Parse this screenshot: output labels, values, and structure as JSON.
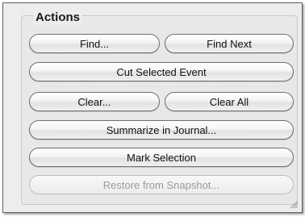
{
  "panel": {
    "title": "Actions"
  },
  "buttons": {
    "find": "Find...",
    "find_next": "Find Next",
    "cut_selected_event": "Cut Selected Event",
    "clear": "Clear...",
    "clear_all": "Clear All",
    "summarize_in_journal": "Summarize in Journal...",
    "mark_selection": "Mark Selection",
    "restore_from_snapshot": "Restore from Snapshot..."
  },
  "icons": {
    "resize_grip": "resize-grip-icon"
  }
}
